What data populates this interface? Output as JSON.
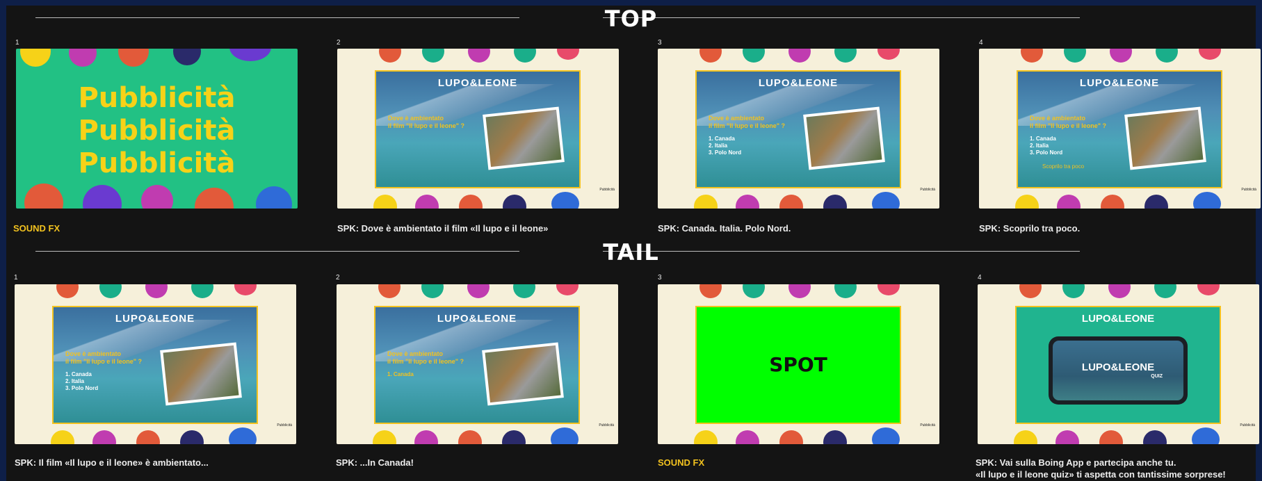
{
  "sections": [
    {
      "title": "TOP",
      "frames": [
        {
          "num": "1",
          "caption": "SOUND FX"
        },
        {
          "num": "2",
          "caption": "SPK: Dove è ambientato il film «Il lupo e il leone»"
        },
        {
          "num": "3",
          "caption": "SPK: Canada. Italia. Polo Nord."
        },
        {
          "num": "4",
          "caption": "SPK: Scoprilo tra poco."
        }
      ]
    },
    {
      "title": "TAIL",
      "frames": [
        {
          "num": "1",
          "caption": "SPK: Il film «Il lupo e il leone» è ambientato..."
        },
        {
          "num": "2",
          "caption": "SPK: ...In Canada!"
        },
        {
          "num": "3",
          "caption": "SOUND FX"
        },
        {
          "num": "4",
          "caption": "SPK: Vai sulla Boing App e partecipa anche tu.\n«Il lupo e il leone quiz» ti aspetta con tantissime sorprese!"
        }
      ]
    }
  ],
  "slides": {
    "pubblicita": [
      "Pubblicità",
      "Pubblicità",
      "Pubblicità"
    ],
    "logo": "LUPO&LEONE",
    "question": "Dove è ambientato\nil film \"Il lupo e il leone\" ?",
    "answers_full": "1. Canada\n2. Italia\n3. Polo Nord",
    "answers_canada": "1. Canada",
    "reveal_hint": "Scoprilo tra poco",
    "pubblicita_tag": "Pubblicità",
    "spot": "SPOT",
    "quiz": "QUIZ"
  },
  "colors": {
    "caption_fx": "#f2c21f",
    "board": "#141414",
    "outer": "#0e1f48",
    "green_screen": "#00ff00"
  }
}
